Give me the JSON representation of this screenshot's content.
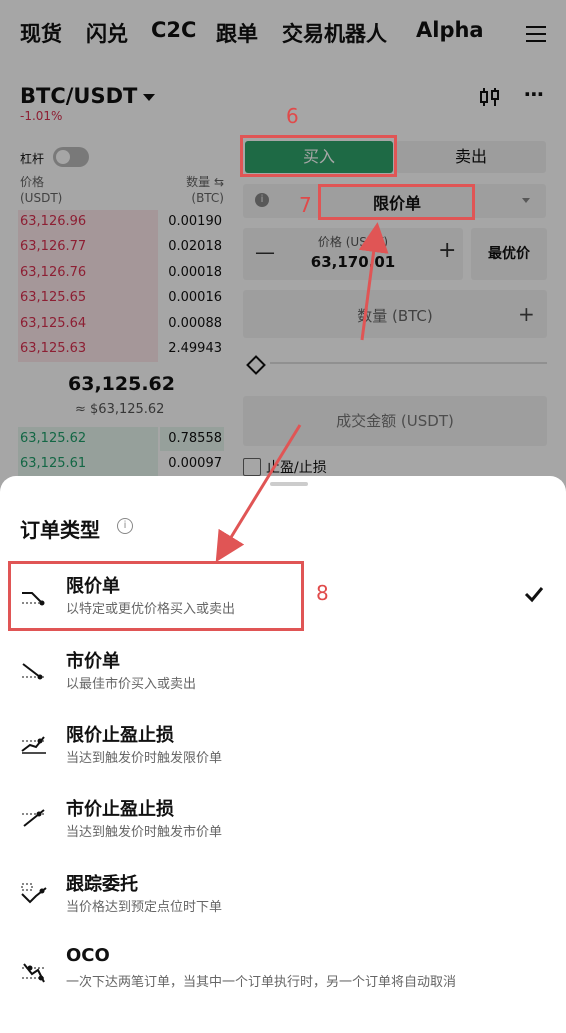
{
  "nav": {
    "items": [
      "现货",
      "闪兑",
      "C2C",
      "跟单",
      "交易机器人",
      "Alpha"
    ]
  },
  "pair": {
    "symbol": "BTC/USDT",
    "change": "-1.01%"
  },
  "orderbook": {
    "leverage_label": "杠杆",
    "price_header": "价格",
    "price_unit": "(USDT)",
    "qty_header": "数量 ⇆",
    "qty_unit": "(BTC)",
    "asks": [
      {
        "price": "63,126.96",
        "qty": "0.00190"
      },
      {
        "price": "63,126.77",
        "qty": "0.02018"
      },
      {
        "price": "63,126.76",
        "qty": "0.00018"
      },
      {
        "price": "63,125.65",
        "qty": "0.00016"
      },
      {
        "price": "63,125.64",
        "qty": "0.00088"
      },
      {
        "price": "63,125.63",
        "qty": "2.49943"
      }
    ],
    "mid_price": "63,125.62",
    "mid_usd": "≈ $63,125.62",
    "bids": [
      {
        "price": "63,125.62",
        "qty": "0.78558"
      },
      {
        "price": "63,125.61",
        "qty": "0.00097"
      }
    ]
  },
  "trade": {
    "buy_label": "买入",
    "sell_label": "卖出",
    "order_type": "限价单",
    "price_label": "价格 (USDT)",
    "price_value": "63,170.01",
    "best_price_label": "最优价",
    "qty_label": "数量 (BTC)",
    "amount_label": "成交金额 (USDT)",
    "tpsl_label": "止盈/止损"
  },
  "sheet": {
    "title": "订单类型",
    "options": [
      {
        "title": "限价单",
        "sub": "以特定或更优价格买入或卖出",
        "icon": "limit-order-icon"
      },
      {
        "title": "市价单",
        "sub": "以最佳市价买入或卖出",
        "icon": "market-order-icon"
      },
      {
        "title": "限价止盈止损",
        "sub": "当达到触发价时触发限价单",
        "icon": "stop-limit-icon"
      },
      {
        "title": "市价止盈止损",
        "sub": "当达到触发价时触发市价单",
        "icon": "stop-market-icon"
      },
      {
        "title": "跟踪委托",
        "sub": "当价格达到预定点位时下单",
        "icon": "trailing-order-icon"
      },
      {
        "title": "OCO",
        "sub": "一次下达两笔订单，当其中一个订单执行时，另一个订单将自动取消",
        "icon": "oco-icon"
      }
    ]
  },
  "annotations": {
    "step6": "6",
    "step7": "7",
    "step8": "8"
  },
  "colors": {
    "buy": "#2fa46a",
    "ask": "#d9304f",
    "bid": "#1e9e6a",
    "annotation": "#e05555"
  }
}
